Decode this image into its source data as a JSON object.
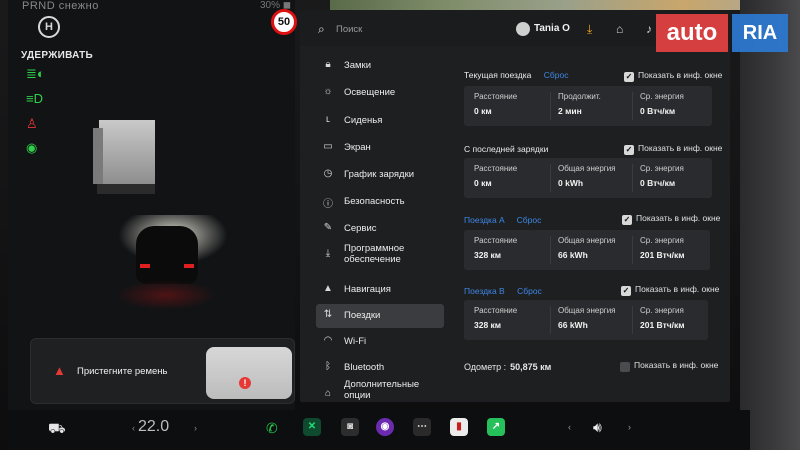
{
  "left": {
    "top_status": "PRND   снежно",
    "top_right": "30% ◼",
    "hold_icon": "H",
    "hold_label": "УДЕРЖИВАТЬ",
    "speed_limit": "50",
    "belt_warning": "Пристегните ремень"
  },
  "topbar": {
    "search_placeholder": "Поиск",
    "user_name": "Tania O",
    "icons": [
      "download-icon",
      "home-icon",
      "bell-icon"
    ]
  },
  "sidebar": {
    "items": [
      {
        "label": "Замки",
        "icon": "lock-icon"
      },
      {
        "label": "Освещение",
        "icon": "light-icon"
      },
      {
        "label": "Сиденья",
        "icon": "seat-icon"
      },
      {
        "label": "Экран",
        "icon": "screen-icon"
      },
      {
        "label": "График зарядки",
        "icon": "schedule-icon"
      },
      {
        "label": "Безопасность",
        "icon": "safety-icon"
      },
      {
        "label": "Сервис",
        "icon": "wrench-icon"
      },
      {
        "label": "Программное обеспечение",
        "icon": "download-icon"
      },
      {
        "label": "Навигация",
        "icon": "navigation-icon"
      },
      {
        "label": "Поездки",
        "icon": "trips-icon",
        "active": true
      },
      {
        "label": "Wi-Fi",
        "icon": "wifi-icon"
      },
      {
        "label": "Bluetooth",
        "icon": "bluetooth-icon"
      },
      {
        "label": "Дополнительные опции",
        "icon": "upgrades-icon"
      }
    ]
  },
  "content": {
    "show_label": "Показать в инф. окне",
    "sections": [
      {
        "title": "Текущая поездка",
        "link": "Сброс",
        "checked": true,
        "stats": [
          {
            "label": "Расстояние",
            "value": "0 км"
          },
          {
            "label": "Продолжит.",
            "value": "2 мин"
          },
          {
            "label": "Ср. энергия",
            "value": "0 Втч/км"
          }
        ]
      },
      {
        "title": "С последней зарядки",
        "link": "",
        "checked": true,
        "stats": [
          {
            "label": "Расстояние",
            "value": "0 км"
          },
          {
            "label": "Общая энергия",
            "value": "0 kWh"
          },
          {
            "label": "Ср. энергия",
            "value": "0 Втч/км"
          }
        ]
      },
      {
        "title": "Поездка A",
        "link": "Сброс",
        "checked": true,
        "stats": [
          {
            "label": "Расстояние",
            "value": "328 км"
          },
          {
            "label": "Общая энергия",
            "value": "66 kWh"
          },
          {
            "label": "Ср. энергия",
            "value": "201 Втч/км"
          }
        ]
      },
      {
        "title": "Поездка B",
        "link": "Сброс",
        "checked": true,
        "stats": [
          {
            "label": "Расстояние",
            "value": "328 км"
          },
          {
            "label": "Общая энергия",
            "value": "66 kWh"
          },
          {
            "label": "Ср. энергия",
            "value": "201 Втч/км"
          }
        ]
      }
    ],
    "odometer_label": "Одометр :",
    "odometer_value": "50,875 км",
    "odometer_checked": false
  },
  "dock": {
    "temperature": "22.0",
    "temp_down": "‹",
    "temp_up": "›",
    "vol_down": "‹",
    "vol_up": "›"
  },
  "watermark": {
    "auto": "auto",
    "ria": "RIA"
  },
  "colors": {
    "accent": "#3e87e6",
    "green": "#2fd14a",
    "red": "#e53935"
  }
}
